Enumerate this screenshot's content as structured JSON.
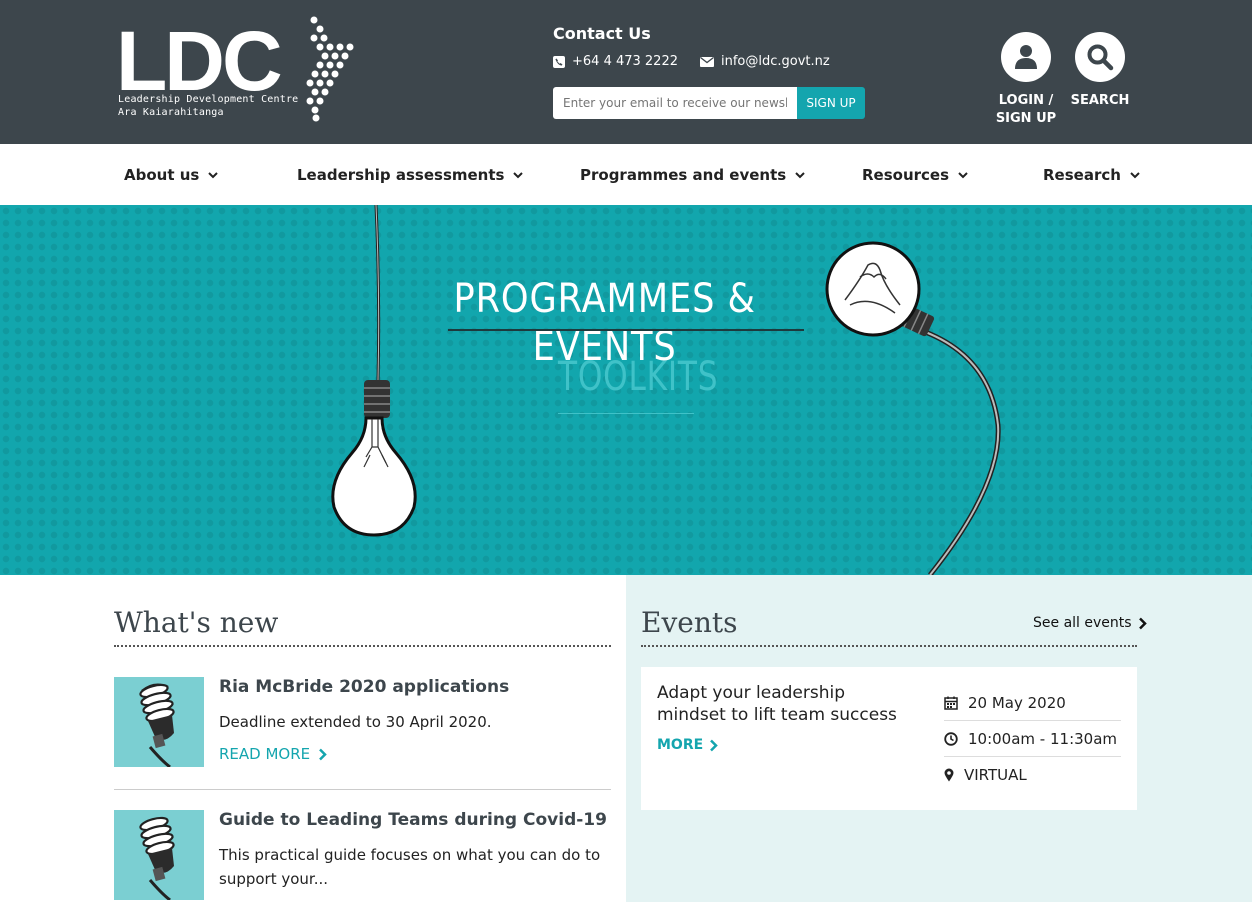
{
  "logo": {
    "wordmark": "LDC",
    "line1": "Leadership Development Centre",
    "line2": "Ara Kaiarahitanga"
  },
  "contact": {
    "title": "Contact Us",
    "phone": "+64 4 473 2222",
    "email": "info@ldc.govt.nz",
    "newsletter_placeholder": "Enter your email to receive our newsletter",
    "signup_label": "SIGN UP"
  },
  "header_actions": {
    "login_line1": "LOGIN /",
    "login_line2": "SIGN UP",
    "search": "SEARCH"
  },
  "nav": {
    "items": [
      {
        "label": "About us"
      },
      {
        "label": "Leadership assessments"
      },
      {
        "label": "Programmes and events"
      },
      {
        "label": "Resources"
      },
      {
        "label": "Research"
      }
    ]
  },
  "hero": {
    "title": "PROGRAMMES & EVENTS",
    "subtitle": "TOOLKITS"
  },
  "whats_new": {
    "title": "What's new",
    "items": [
      {
        "title": "Ria McBride 2020 applications",
        "desc": "Deadline extended to 30 April 2020.",
        "link": "READ MORE"
      },
      {
        "title": "Guide to Leading Teams during Covid-19",
        "desc": "This practical guide focuses on what you can do to support your..."
      }
    ]
  },
  "events": {
    "title": "Events",
    "see_all": "See all events",
    "card": {
      "title": "Adapt your leadership mindset to lift team success",
      "more": "MORE",
      "date": "20 May 2020",
      "time": "10:00am - 11:30am",
      "location": "VIRTUAL"
    }
  },
  "colors": {
    "header_bg": "#3d464c",
    "accent": "#14a5ae",
    "hero_bg": "#12a6ad",
    "events_bg": "#e4f3f3"
  }
}
